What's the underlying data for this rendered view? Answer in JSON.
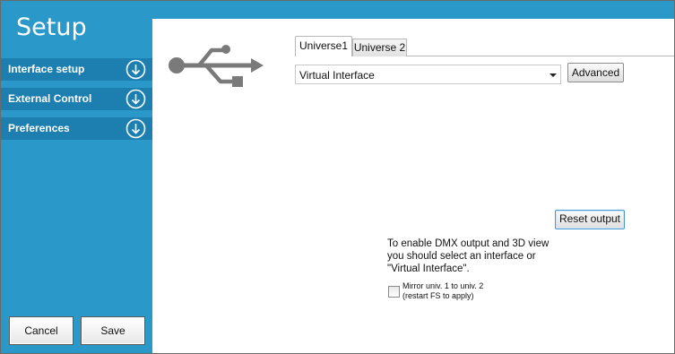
{
  "sidebar": {
    "title": "Setup",
    "items": [
      {
        "label": "Interface setup",
        "icon": "arrow-down-circle-icon"
      },
      {
        "label": "External Control",
        "icon": "arrow-down-circle-icon"
      },
      {
        "label": "Preferences",
        "icon": "arrow-down-circle-icon"
      }
    ],
    "cancel_label": "Cancel",
    "save_label": "Save"
  },
  "main": {
    "icon": "usb-icon",
    "tabs": [
      {
        "label": "Universe1",
        "active": true
      },
      {
        "label": "Universe 2",
        "active": false
      }
    ],
    "interface_select": {
      "value": "Virtual Interface"
    },
    "advanced_label": "Advanced",
    "reset_label": "Reset output",
    "hint_lines": [
      "To enable DMX output and 3D view",
      "you should select an interface or",
      "\"Virtual Interface\"."
    ],
    "mirror": {
      "checked": false,
      "line1": "Mirror univ. 1 to univ. 2",
      "line2": "(restart FS to apply)"
    }
  },
  "colors": {
    "accent": "#2a98c9",
    "sidebar_item": "#1c7fb0"
  }
}
